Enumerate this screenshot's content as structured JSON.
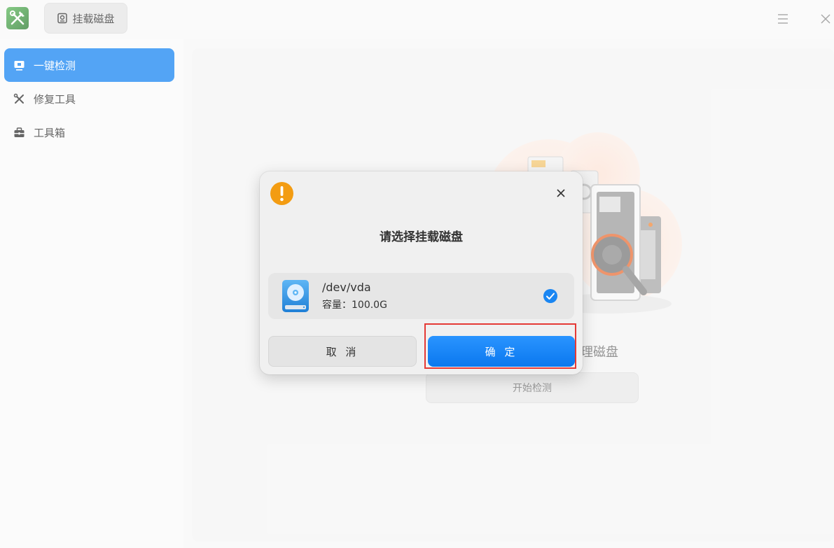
{
  "titlebar": {
    "app_icon": "tools-icon",
    "mount_button_label": "挂载磁盘",
    "mount_button_icon": "disk-icon",
    "menu_icon": "hamburger-menu-icon",
    "close_icon": "close-icon"
  },
  "sidebar": {
    "items": [
      {
        "label": "一键检测",
        "icon": "monitor-icon",
        "active": true
      },
      {
        "label": "修复工具",
        "icon": "wrench-icon",
        "active": false
      },
      {
        "label": "工具箱",
        "icon": "toolbox-icon",
        "active": false
      }
    ]
  },
  "main": {
    "description": "检测系统错误并清理磁盘",
    "start_button_label": "开始检测"
  },
  "dialog": {
    "title": "请选择挂载磁盘",
    "disk": {
      "name": "/dev/vda",
      "capacity": "容量：100.0G",
      "selected": true
    },
    "cancel_label": "取 消",
    "confirm_label": "确 定"
  },
  "colors": {
    "accent": "#1a86f2",
    "warning": "#f39c12",
    "highlight": "#e53935"
  }
}
